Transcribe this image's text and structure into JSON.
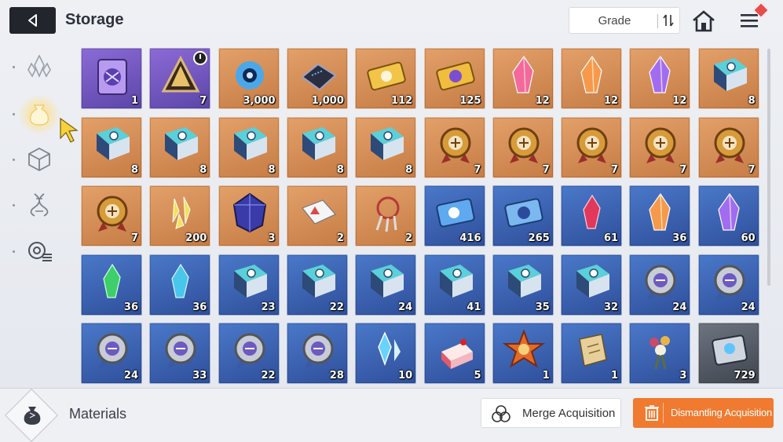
{
  "header": {
    "title": "Storage",
    "sort_label": "Grade"
  },
  "sidebar": {
    "items": [
      {
        "icon": "crystal-icon",
        "active": false
      },
      {
        "icon": "pouch-icon",
        "active": true
      },
      {
        "icon": "cube-icon",
        "active": false
      },
      {
        "icon": "dna-icon",
        "active": false
      },
      {
        "icon": "gear-list-icon",
        "active": false
      }
    ]
  },
  "grid": {
    "items": [
      {
        "icon": "purple-card",
        "rarity": "purple",
        "count": "1"
      },
      {
        "icon": "pyramid",
        "rarity": "purple",
        "count": "7",
        "timer": true
      },
      {
        "icon": "blue-orb",
        "rarity": "orange",
        "count": "3,000"
      },
      {
        "icon": "chip",
        "rarity": "orange",
        "count": "1,000"
      },
      {
        "icon": "gold-ticket",
        "rarity": "orange",
        "count": "112"
      },
      {
        "icon": "gold-ticket-2",
        "rarity": "orange",
        "count": "125"
      },
      {
        "icon": "pink-crystal",
        "rarity": "orange",
        "count": "12"
      },
      {
        "icon": "orange-crystal",
        "rarity": "orange",
        "count": "12"
      },
      {
        "icon": "purple-crystal",
        "rarity": "orange",
        "count": "12"
      },
      {
        "icon": "book",
        "rarity": "orange",
        "count": "8"
      },
      {
        "icon": "book",
        "rarity": "orange",
        "count": "8"
      },
      {
        "icon": "book",
        "rarity": "orange",
        "count": "8"
      },
      {
        "icon": "book",
        "rarity": "orange",
        "count": "8"
      },
      {
        "icon": "book",
        "rarity": "orange",
        "count": "8"
      },
      {
        "icon": "book",
        "rarity": "orange",
        "count": "8"
      },
      {
        "icon": "medal",
        "rarity": "orange",
        "count": "7"
      },
      {
        "icon": "medal",
        "rarity": "orange",
        "count": "7"
      },
      {
        "icon": "medal",
        "rarity": "orange",
        "count": "7"
      },
      {
        "icon": "medal",
        "rarity": "orange",
        "count": "7"
      },
      {
        "icon": "medal",
        "rarity": "orange",
        "count": "7"
      },
      {
        "icon": "medal",
        "rarity": "orange",
        "count": "7"
      },
      {
        "icon": "yellow-shards",
        "rarity": "orange",
        "count": "200"
      },
      {
        "icon": "dark-gem",
        "rarity": "orange",
        "count": "3"
      },
      {
        "icon": "papers",
        "rarity": "orange",
        "count": "2"
      },
      {
        "icon": "dreamcatcher",
        "rarity": "orange",
        "count": "2"
      },
      {
        "icon": "blue-ticket",
        "rarity": "blue",
        "count": "416"
      },
      {
        "icon": "blue-ticket-2",
        "rarity": "blue",
        "count": "265"
      },
      {
        "icon": "red-crystal",
        "rarity": "blue",
        "count": "61"
      },
      {
        "icon": "orange-crystal",
        "rarity": "blue",
        "count": "36"
      },
      {
        "icon": "purple-crystal",
        "rarity": "blue",
        "count": "60"
      },
      {
        "icon": "green-crystal",
        "rarity": "blue",
        "count": "36"
      },
      {
        "icon": "cyan-crystal",
        "rarity": "blue",
        "count": "36"
      },
      {
        "icon": "book",
        "rarity": "blue",
        "count": "23"
      },
      {
        "icon": "book",
        "rarity": "blue",
        "count": "22"
      },
      {
        "icon": "book",
        "rarity": "blue",
        "count": "24"
      },
      {
        "icon": "book",
        "rarity": "blue",
        "count": "41"
      },
      {
        "icon": "book",
        "rarity": "blue",
        "count": "35"
      },
      {
        "icon": "book",
        "rarity": "blue",
        "count": "32"
      },
      {
        "icon": "silver-medal",
        "rarity": "blue",
        "count": "24"
      },
      {
        "icon": "silver-medal",
        "rarity": "blue",
        "count": "24"
      },
      {
        "icon": "silver-medal",
        "rarity": "blue",
        "count": "24"
      },
      {
        "icon": "silver-medal",
        "rarity": "blue",
        "count": "33"
      },
      {
        "icon": "silver-medal",
        "rarity": "blue",
        "count": "22"
      },
      {
        "icon": "silver-medal",
        "rarity": "blue",
        "count": "28"
      },
      {
        "icon": "ice-shard",
        "rarity": "blue",
        "count": "10"
      },
      {
        "icon": "cake",
        "rarity": "blue",
        "count": "5"
      },
      {
        "icon": "star-badge",
        "rarity": "blue",
        "count": "1"
      },
      {
        "icon": "scroll",
        "rarity": "blue",
        "count": "1"
      },
      {
        "icon": "bouquet",
        "rarity": "blue",
        "count": "3"
      },
      {
        "icon": "grey-ticket",
        "rarity": "grey",
        "count": "729"
      }
    ]
  },
  "footer": {
    "category_label": "Materials",
    "merge_label": "Merge Acquisition",
    "dismantle_label": "Dismantling Acquisition"
  },
  "colors": {
    "accent_orange": "#f07a30",
    "rarity_purple": "#6e55c0",
    "rarity_orange": "#d48a52",
    "rarity_blue": "#3c63b3",
    "rarity_grey": "#555b66"
  }
}
